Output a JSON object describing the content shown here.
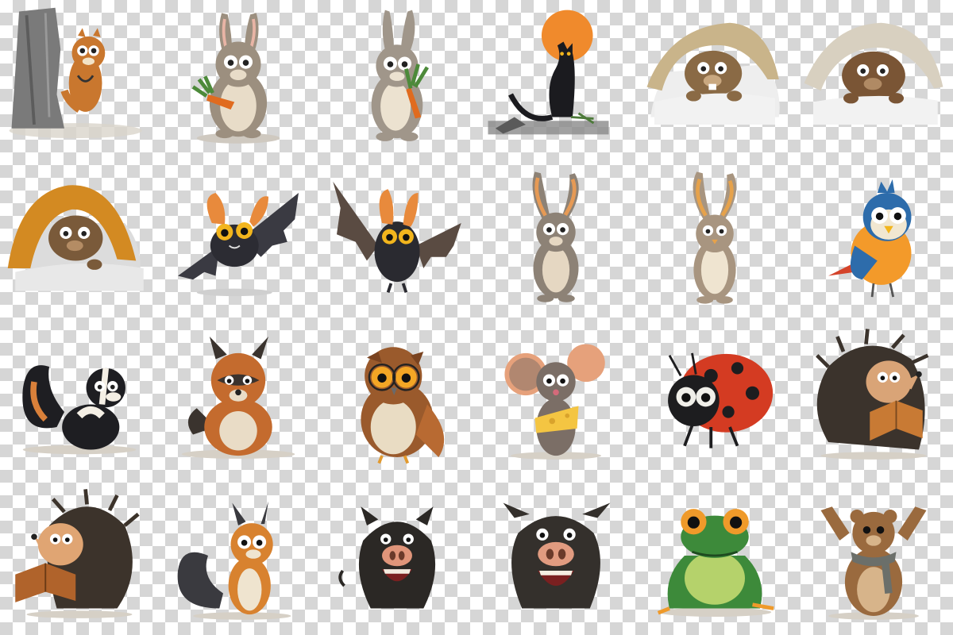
{
  "sheet": {
    "background": "transparent-checkerboard",
    "checker_colors": [
      "#ffffff",
      "#d6d6d6"
    ],
    "columns": 6,
    "rows": 4
  },
  "illustrations": [
    {
      "subject": "chipmunk-behind-tree",
      "palette": [
        "#7a7a7a",
        "#c9772e",
        "#f2e3c7"
      ]
    },
    {
      "subject": "rabbit-holding-carrots",
      "palette": [
        "#9c8f7f",
        "#e8dcc8",
        "#e06b1f",
        "#4d8a3a"
      ]
    },
    {
      "subject": "rabbit-holding-carrots",
      "palette": [
        "#a0968a",
        "#ece2d0",
        "#e06b1f",
        "#4d8a3a"
      ]
    },
    {
      "subject": "black-cat-with-orange-moon",
      "palette": [
        "#1b1b1f",
        "#f08a2c",
        "#6b6b6b"
      ]
    },
    {
      "subject": "beaver-under-blanket",
      "palette": [
        "#8a6a45",
        "#c9b48a",
        "#eeeeee"
      ]
    },
    {
      "subject": "beaver-under-blanket",
      "palette": [
        "#7a5535",
        "#d8d0c0",
        "#f2f2f2"
      ]
    },
    {
      "subject": "beaver-under-orange-blanket",
      "palette": [
        "#7a5a3a",
        "#d38a22",
        "#dcdcdc"
      ]
    },
    {
      "subject": "bat-flying",
      "palette": [
        "#2c2c33",
        "#e88a3c",
        "#f2b51d"
      ]
    },
    {
      "subject": "bat-wings-open",
      "palette": [
        "#2a2a30",
        "#5a4b42",
        "#f2b51d"
      ]
    },
    {
      "subject": "rabbit-standing",
      "palette": [
        "#8d8276",
        "#e5d7c2",
        "#e69a55"
      ]
    },
    {
      "subject": "rabbit-standing",
      "palette": [
        "#a89580",
        "#efe4d0",
        "#e6a24b"
      ]
    },
    {
      "subject": "bird-blue-orange",
      "palette": [
        "#2d6cab",
        "#f39a2a",
        "#f1e7d1"
      ]
    },
    {
      "subject": "skunk",
      "palette": [
        "#1e1e22",
        "#f4efe5",
        "#d9803a"
      ]
    },
    {
      "subject": "raccoon",
      "palette": [
        "#c46b2e",
        "#3a332e",
        "#e9dcc6"
      ]
    },
    {
      "subject": "owl-with-glasses",
      "palette": [
        "#9a5a2c",
        "#e9dcc3",
        "#f3a625"
      ]
    },
    {
      "subject": "mouse-holding-cheese",
      "palette": [
        "#7b6e66",
        "#e6a17b",
        "#f4c542"
      ]
    },
    {
      "subject": "ladybug",
      "palette": [
        "#d43b22",
        "#1d1d1f",
        "#f0efe9"
      ]
    },
    {
      "subject": "hedgehog-reading-book",
      "palette": [
        "#3b332c",
        "#d9a477",
        "#c87a34"
      ]
    },
    {
      "subject": "hedgehog-reading-book",
      "palette": [
        "#3c332b",
        "#e0a573",
        "#b0632b"
      ]
    },
    {
      "subject": "squirrel-gray-orange",
      "palette": [
        "#3a3a3f",
        "#d8822f",
        "#efe4cf"
      ]
    },
    {
      "subject": "wild-boar-laughing",
      "palette": [
        "#2b2825",
        "#e0957a",
        "#f3ece0"
      ]
    },
    {
      "subject": "wild-boar-laughing",
      "palette": [
        "#34302c",
        "#e19b80",
        "#f5eee2"
      ]
    },
    {
      "subject": "frog-green",
      "palette": [
        "#3d8a3a",
        "#ef9a2a",
        "#b5d26b"
      ]
    },
    {
      "subject": "bear-waving-with-scarf",
      "palette": [
        "#9a6a3e",
        "#d7b48a",
        "#6b6f6a"
      ]
    }
  ]
}
